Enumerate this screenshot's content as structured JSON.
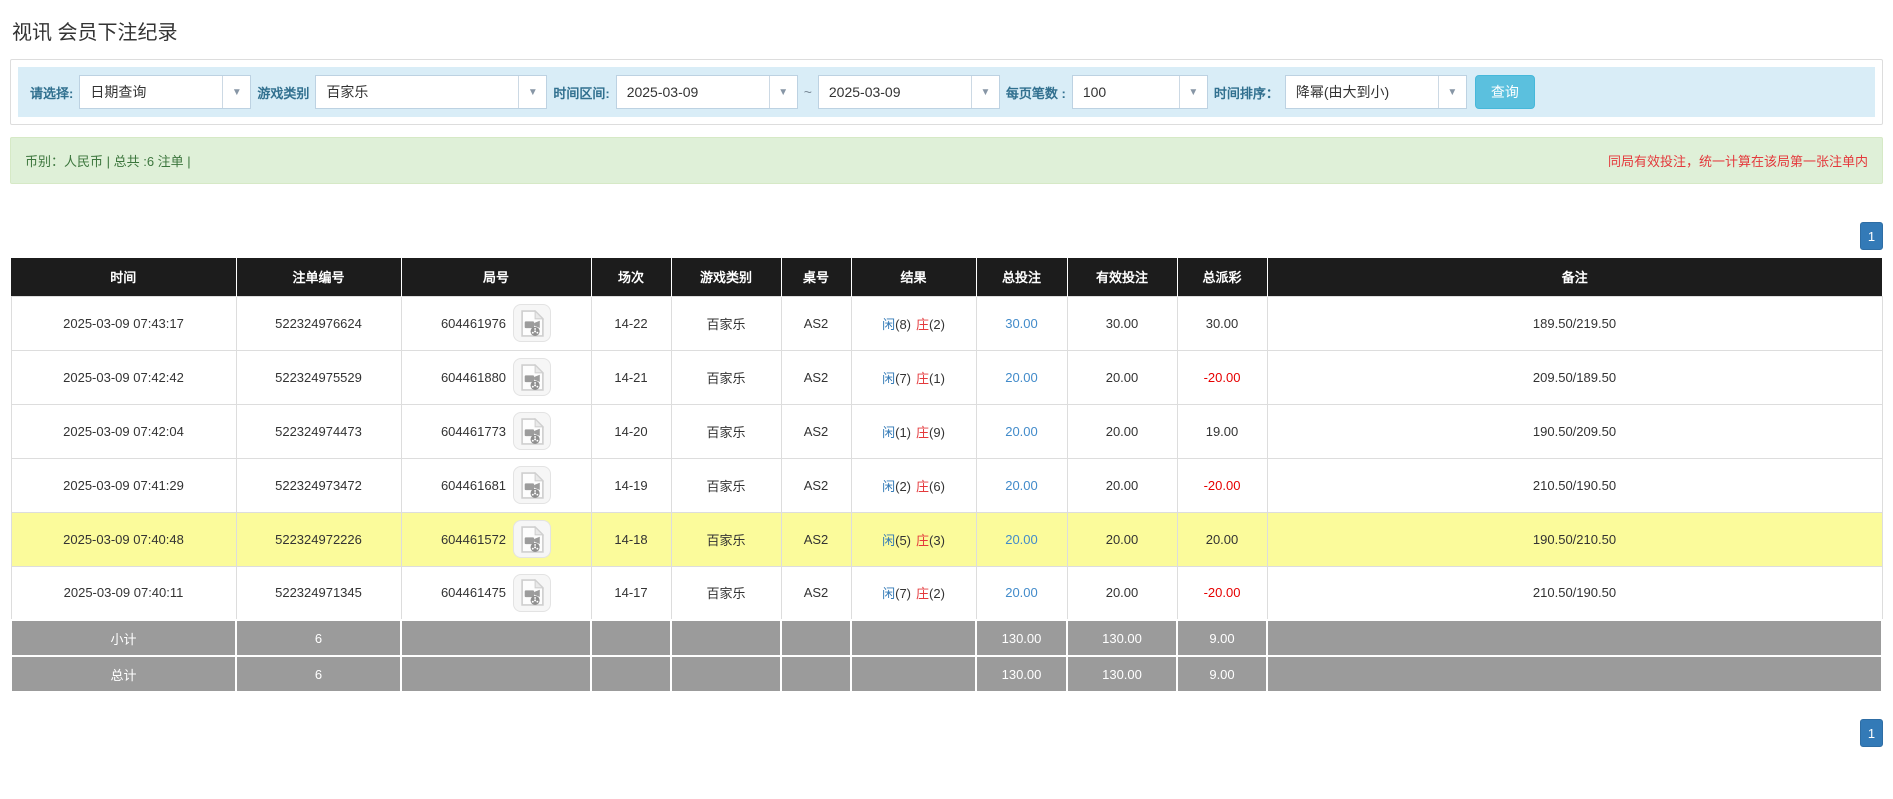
{
  "page": {
    "title": "视讯 会员下注纪录"
  },
  "filters": {
    "select_label": "请选择:",
    "select_value": "日期查询",
    "game_type_label": "游戏类别",
    "game_type_value": "百家乐",
    "time_range_label": "时间区间:",
    "date_from": "2025-03-09",
    "range_separator": "~",
    "date_to": "2025-03-09",
    "page_size_label": "每页笔数 :",
    "page_size_value": "100",
    "sort_label": "时间排序：",
    "sort_value": "降幂(由大到小)",
    "search_button": "查询",
    "dropdown_icon": "▼"
  },
  "summary": {
    "currency_info": "币别：人民币 | 总共 :6 注单 |",
    "note": "同局有效投注，统一计算在该局第一张注单内"
  },
  "pagination": {
    "current_page": "1"
  },
  "table": {
    "headers": [
      "时间",
      "注单编号",
      "局号",
      "场次",
      "游戏类别",
      "桌号",
      "结果",
      "总投注",
      "有效投注",
      "总派彩",
      "备注"
    ],
    "rows": [
      {
        "time": "2025-03-09 07:43:17",
        "order_no": "522324976624",
        "round_no": "604461976",
        "session": "14-22",
        "game": "百家乐",
        "table_no": "AS2",
        "result_player": "闲",
        "result_player_num": "(8)",
        "result_banker": "庄",
        "result_banker_num": "(2)",
        "total_bet": "30.00",
        "valid_bet": "30.00",
        "payout": "30.00",
        "remark": "189.50/219.50",
        "highlighted": false
      },
      {
        "time": "2025-03-09 07:42:42",
        "order_no": "522324975529",
        "round_no": "604461880",
        "session": "14-21",
        "game": "百家乐",
        "table_no": "AS2",
        "result_player": "闲",
        "result_player_num": "(7)",
        "result_banker": "庄",
        "result_banker_num": "(1)",
        "total_bet": "20.00",
        "valid_bet": "20.00",
        "payout": "-20.00",
        "remark": "209.50/189.50",
        "highlighted": false
      },
      {
        "time": "2025-03-09 07:42:04",
        "order_no": "522324974473",
        "round_no": "604461773",
        "session": "14-20",
        "game": "百家乐",
        "table_no": "AS2",
        "result_player": "闲",
        "result_player_num": "(1)",
        "result_banker": "庄",
        "result_banker_num": "(9)",
        "total_bet": "20.00",
        "valid_bet": "20.00",
        "payout": "19.00",
        "remark": "190.50/209.50",
        "highlighted": false
      },
      {
        "time": "2025-03-09 07:41:29",
        "order_no": "522324973472",
        "round_no": "604461681",
        "session": "14-19",
        "game": "百家乐",
        "table_no": "AS2",
        "result_player": "闲",
        "result_player_num": "(2)",
        "result_banker": "庄",
        "result_banker_num": "(6)",
        "total_bet": "20.00",
        "valid_bet": "20.00",
        "payout": "-20.00",
        "remark": "210.50/190.50",
        "highlighted": false
      },
      {
        "time": "2025-03-09 07:40:48",
        "order_no": "522324972226",
        "round_no": "604461572",
        "session": "14-18",
        "game": "百家乐",
        "table_no": "AS2",
        "result_player": "闲",
        "result_player_num": "(5)",
        "result_banker": "庄",
        "result_banker_num": "(3)",
        "total_bet": "20.00",
        "valid_bet": "20.00",
        "payout": "20.00",
        "remark": "190.50/210.50",
        "highlighted": true
      },
      {
        "time": "2025-03-09 07:40:11",
        "order_no": "522324971345",
        "round_no": "604461475",
        "session": "14-17",
        "game": "百家乐",
        "table_no": "AS2",
        "result_player": "闲",
        "result_player_num": "(7)",
        "result_banker": "庄",
        "result_banker_num": "(2)",
        "total_bet": "20.00",
        "valid_bet": "20.00",
        "payout": "-20.00",
        "remark": "210.50/190.50",
        "highlighted": false
      }
    ],
    "subtotal": {
      "label": "小计",
      "count": "6",
      "total_bet": "130.00",
      "valid_bet": "130.00",
      "payout": "9.00"
    },
    "total": {
      "label": "总计",
      "count": "6",
      "total_bet": "130.00",
      "valid_bet": "130.00",
      "payout": "9.00"
    }
  },
  "colors": {
    "filter_bg": "#d9edf7",
    "search_blue": "#5bc0de",
    "success_bg": "#dff0d8",
    "success_text": "#3c763d",
    "pager_blue": "#337ab7",
    "header_black": "#1c1c1c",
    "highlight_yellow": "#fbfb9b",
    "summary_gray": "#9b9b9b",
    "accent_blue": "#428bca",
    "negative_red": "#e60000",
    "player_blue": "#337ab7",
    "banker_red": "#e4393c"
  }
}
